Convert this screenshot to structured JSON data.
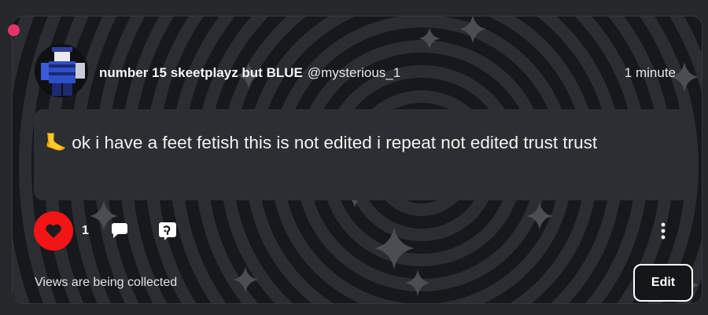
{
  "post": {
    "username": "number 15 skeetplayz but BLUE",
    "handle": "@mysterious_1",
    "timestamp": "1 minute",
    "emoji": "🦶",
    "text": "ok i have a feet fetish this is not edited i repeat not edited trust trust"
  },
  "actions": {
    "like_count": "1",
    "like_icon": "heart-icon",
    "comment_icon": "speech-bubble-icon",
    "share_icon": "quote-share-icon",
    "more_icon": "kebab-menu-icon"
  },
  "footer": {
    "views_text": "Views are being collected",
    "edit_label": "Edit"
  },
  "colors": {
    "like_red": "#f31415",
    "notification_pink": "#e8336a",
    "card_background": "#1b1d20",
    "bubble_background": "#2b2e32"
  }
}
